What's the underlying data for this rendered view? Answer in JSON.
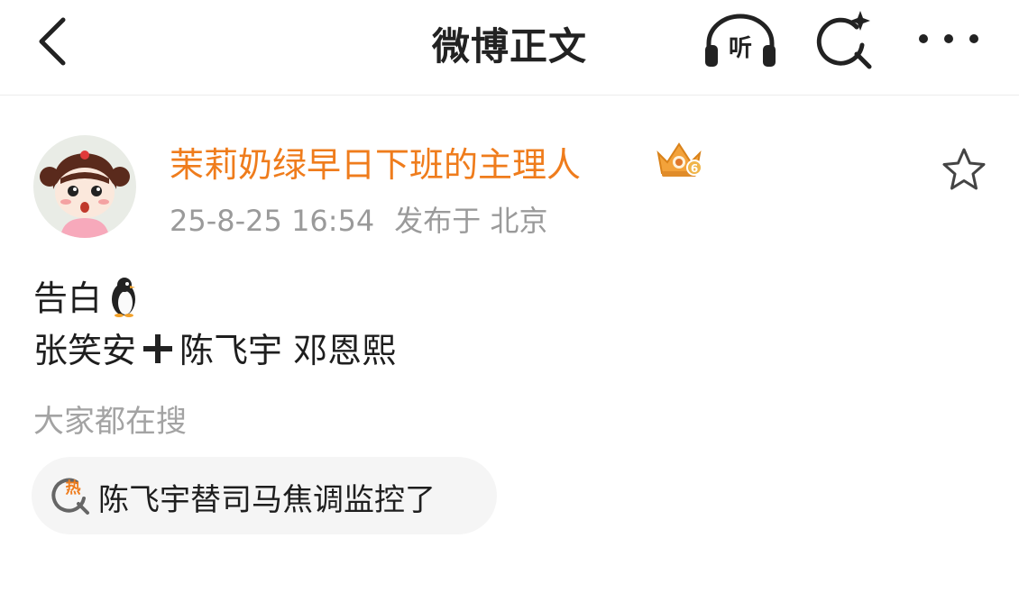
{
  "header": {
    "title": "微博正文",
    "listen_label": "听"
  },
  "post": {
    "author": "茉莉奶绿早日下班的主理人",
    "vip_level": "6",
    "time": "25-8-25 16:54",
    "location": "发布于 北京",
    "line1": "告白",
    "line2_left": "张笑安",
    "line2_right": "陈飞宇 邓恩熙"
  },
  "related": {
    "label": "大家都在搜",
    "hot_icon_text": "热",
    "hot_query": "陈飞宇替司马焦调监控了"
  },
  "colors": {
    "accent_orange": "#ef7c1c",
    "meta_gray": "#9a9a9a",
    "chip_bg": "#f5f5f5"
  },
  "icons": {
    "back": "chevron-left-icon",
    "listen": "headphones-icon",
    "search": "sparkle-search-icon",
    "more": "more-dots-icon",
    "favorite": "star-outline-icon",
    "hot": "hot-search-icon"
  }
}
